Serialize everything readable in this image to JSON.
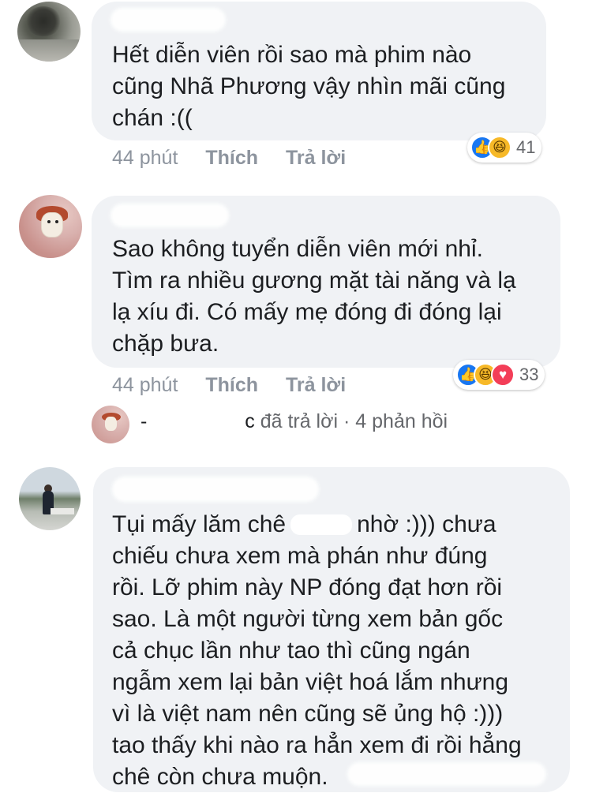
{
  "comments": [
    {
      "text_lines": [
        "Hết diễn viên rồi sao mà phim nào",
        "cũng Nhã Phương vậy nhìn mãi cũng",
        "chán :(("
      ],
      "time": "44 phút",
      "like_label": "Thích",
      "reply_label": "Trả lời",
      "reaction_icons": [
        "like-icon",
        "haha-icon"
      ],
      "reaction_count": "41"
    },
    {
      "text_lines": [
        "Sao không tuyển diễn viên mới nhỉ.",
        "Tìm ra nhiều gương mặt tài năng và lạ",
        "lạ xíu đi. Có mấy mẹ đóng đi đóng lại",
        "chặp bưa."
      ],
      "time": "44 phút",
      "like_label": "Thích",
      "reply_label": "Trả lời",
      "reaction_icons": [
        "like-icon",
        "haha-icon",
        "love-icon"
      ],
      "reaction_count": "33",
      "reply_summary": {
        "name_fragment_start": "-",
        "name_fragment_end": "c",
        "text": "đã trả lời · 4 phản hồi"
      }
    },
    {
      "text_lines": [
        "Tụi mấy lăm chê",
        "nhờ :))) chưa",
        "chiếu chưa xem mà phán như đúng",
        "rồi. Lỡ phim này NP đóng đạt hơn rồi",
        "sao. Là một người từng xem bản gốc",
        "cả chục lần như tao thì cũng ngán",
        "ngẫm xem lại bản việt hoá lắm nhưng",
        "vì là việt nam nên cũng sẽ ủng hộ :)))",
        "tao thấy khi nào ra hẳn xem đi rồi hẳng",
        "chê còn chưa muộn."
      ]
    }
  ],
  "colors": {
    "bubble": "#f0f2f5",
    "text": "#1c1e21",
    "meta": "#8d949e",
    "like": "#1877f2",
    "haha": "#f7b928",
    "love": "#f33e58"
  }
}
